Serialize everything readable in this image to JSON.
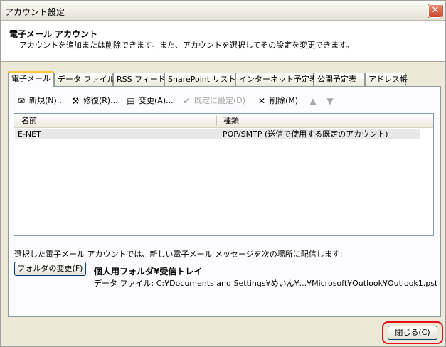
{
  "window": {
    "title": "アカウント設定",
    "close_glyph": "✕"
  },
  "header": {
    "title": "電子メール アカウント",
    "description": "アカウントを追加または削除できます。また、アカウントを選択してその設定を変更できます。"
  },
  "tabs": [
    "電子メール",
    "データ ファイル",
    "RSS フィード",
    "SharePoint リスト",
    "インターネット予定表",
    "公開予定表",
    "アドレス帳"
  ],
  "toolbar": {
    "new_label": "新規(N)...",
    "repair_label": "修復(R)...",
    "change_label": "変更(A)...",
    "default_label": "既定に設定(D)",
    "delete_label": "削除(M)",
    "up_glyph": "▲",
    "down_glyph": "▼"
  },
  "list": {
    "columns": [
      "名前",
      "種類"
    ],
    "rows": [
      {
        "name": "E-NET",
        "type": "POP/SMTP (送信で使用する既定のアカウント)"
      }
    ]
  },
  "delivery": {
    "text": "選択した電子メール アカウントでは、新しい電子メール メッセージを次の場所に配信します:",
    "change_folder_label": "フォルダの変更(F)",
    "folder_name": "個人用フォルダ¥受信トレイ",
    "data_file": "データ ファイル: C:¥Documents and Settings¥めいん¥...¥Microsoft¥Outlook¥Outlook1.pst"
  },
  "footer": {
    "close_label": "閉じる(C)"
  },
  "colors": {
    "highlight_ring": "#e8101a",
    "active_tab_accent": "#ffc83c"
  }
}
